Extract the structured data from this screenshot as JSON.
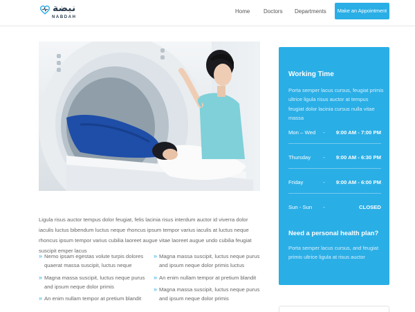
{
  "brand": {
    "arabic_name": "نبضة",
    "latin_name": "NABDAH",
    "accent_color": "#2aaee6"
  },
  "nav": {
    "items": [
      {
        "label": "Home"
      },
      {
        "label": "Doctors"
      },
      {
        "label": "Departments"
      }
    ],
    "cta_label": "Make an Appointment"
  },
  "main": {
    "intro": "Ligula risus auctor tempus dolor feugiat, felis lacinia risus interdum auctor id viverra dolor iaculis luctus bibendum luctus neque rhoncus ipsum tempor varius iaculis at luctus neque rhoncus ipsum tempor varius cubilia laoreet augue vitae laoreet augue undo cubilia feugiat suscipit emper lacus",
    "list_col1": [
      "Nemo ipsam egestas volute turpis dolores quaerat massa suscipit, luctus neque",
      "Magna massa suscipit, luctus neque purus and ipsum neque dolor primis",
      "An enim nullam tempor at pretium blandit"
    ],
    "list_col2": [
      "Magna massa suscipit, luctus neque purus and ipsum neque dolor primis luctus",
      "An enim nullam tempor at pretium blandit",
      "Magna massa suscipit, luctus neque purus and ipsum neque dolor primis"
    ]
  },
  "sidebar": {
    "title": "Working Time",
    "description": "Porta semper lacus cursus, feugiat primis ultrice ligula risus auctor at tempus feugiat dolor lacinia cursus nulla vitae massa",
    "hours": [
      {
        "day": "Mon – Wed",
        "dash": "-",
        "time": "9:00 AM - 7:00 PM"
      },
      {
        "day": "Thursday",
        "dash": "-",
        "time": "9:00 AM - 6:30 PM"
      },
      {
        "day": "Friday",
        "dash": "-",
        "time": "9:00 AM - 6:00 PM"
      },
      {
        "day": "Sun - Sun",
        "dash": "-",
        "time": "CLOSED"
      }
    ],
    "plan_title": "Need a personal health plan?",
    "plan_description": "Porta semper lacus cursus, and feugiat primis ultrice ligula at risus auctor"
  }
}
